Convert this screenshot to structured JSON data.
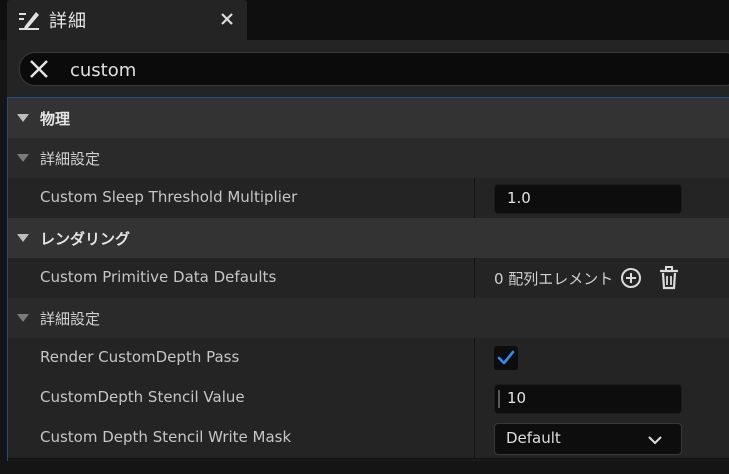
{
  "tab": {
    "icon": "pencil-details-icon",
    "title": "詳細",
    "close_icon": "close-icon"
  },
  "search": {
    "value": "custom",
    "clear_icon": "clear-x-icon"
  },
  "colors": {
    "accent_blue": "#1e4c86",
    "check_blue": "#2f8ef4"
  },
  "panel": {
    "physics": {
      "label": "物理",
      "advanced": {
        "label": "詳細設定"
      },
      "sleep_threshold": {
        "label": "Custom Sleep Threshold Multiplier",
        "value": "1.0"
      }
    },
    "rendering": {
      "label": "レンダリング",
      "primitive_data": {
        "label": "Custom Primitive Data Defaults",
        "count_text": "0 配列エレメント",
        "add_icon": "plus-circle-icon",
        "delete_icon": "trash-icon"
      },
      "advanced": {
        "label": "詳細設定"
      },
      "custom_depth_pass": {
        "label": "Render CustomDepth Pass",
        "checked": true
      },
      "stencil_value": {
        "label": "CustomDepth Stencil Value",
        "value": "10"
      },
      "stencil_write_mask": {
        "label": "Custom Depth Stencil Write Mask",
        "selected": "Default"
      }
    }
  }
}
